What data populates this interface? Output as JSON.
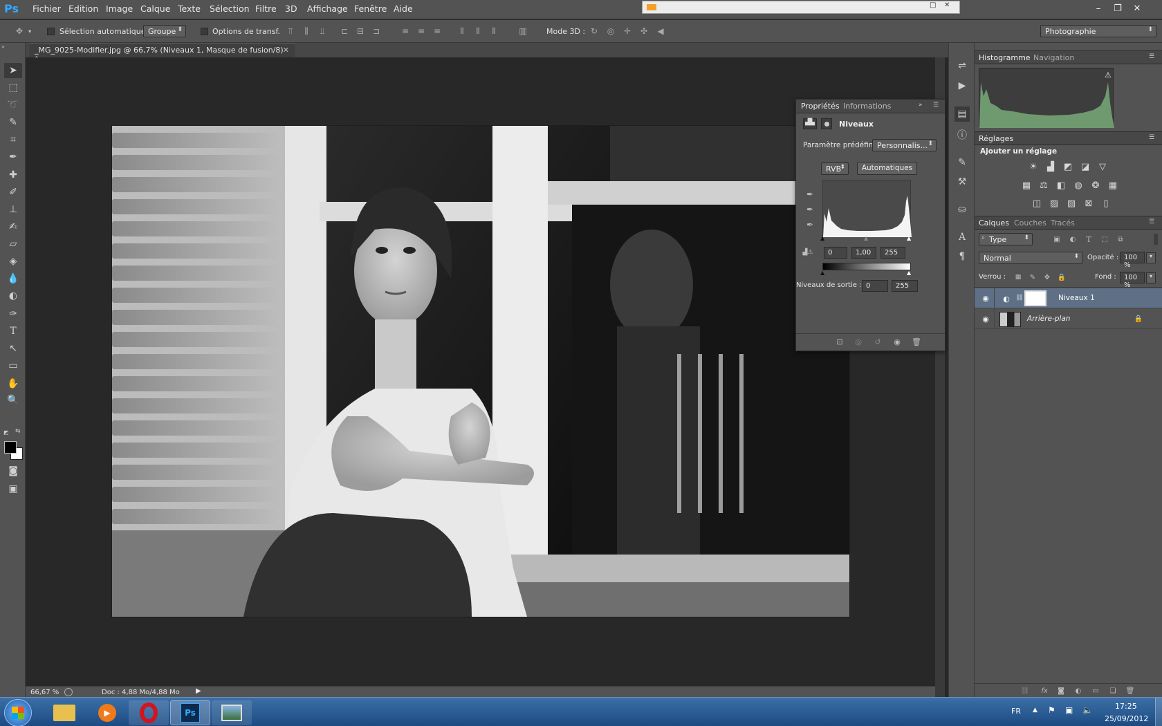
{
  "app": {
    "logo": "Ps"
  },
  "menu": [
    "Fichier",
    "Edition",
    "Image",
    "Calque",
    "Texte",
    "Sélection",
    "Filtre",
    "3D",
    "Affichage",
    "Fenêtre",
    "Aide"
  ],
  "options_bar": {
    "auto_select_label": "Sélection automatique :",
    "auto_select_value": "Groupe",
    "transform_label": "Options de transf.",
    "mode3d_label": "Mode 3D :",
    "workspace": "Photographie"
  },
  "document": {
    "tab_title": "_MG_9025-Modifier.jpg @ 66,7% (Niveaux 1, Masque de fusion/8) *",
    "zoom": "66,67 %",
    "doc_size": "Doc : 4,88 Mo/4,88 Mo"
  },
  "properties_panel": {
    "tab_props": "Propriétés",
    "tab_info": "Informations",
    "title": "Niveaux",
    "preset_label": "Paramètre prédéfini :",
    "preset_value": "Personnalis...",
    "channel": "RVB",
    "auto_button": "Automatiques",
    "input_black": "0",
    "input_gamma": "1,00",
    "input_white": "255",
    "output_label": "Niveaux de sortie :",
    "output_black": "0",
    "output_white": "255"
  },
  "histogram_panel": {
    "tab_histogram": "Histogramme",
    "tab_navigation": "Navigation"
  },
  "adjustments_panel": {
    "tab": "Réglages",
    "subtitle": "Ajouter un réglage"
  },
  "layers_panel": {
    "tab_layers": "Calques",
    "tab_channels": "Couches",
    "tab_paths": "Tracés",
    "filter_type": "Type",
    "blend_mode": "Normal",
    "opacity_label": "Opacité :",
    "opacity_value": "100 %",
    "lock_label": "Verrou :",
    "fill_label": "Fond :",
    "fill_value": "100 %",
    "layers": [
      {
        "name": "Niveaux 1",
        "selected": true
      },
      {
        "name": "Arrière-plan",
        "selected": false
      }
    ]
  },
  "taskbar": {
    "language": "FR",
    "time": "17:25",
    "date": "25/09/2012"
  }
}
